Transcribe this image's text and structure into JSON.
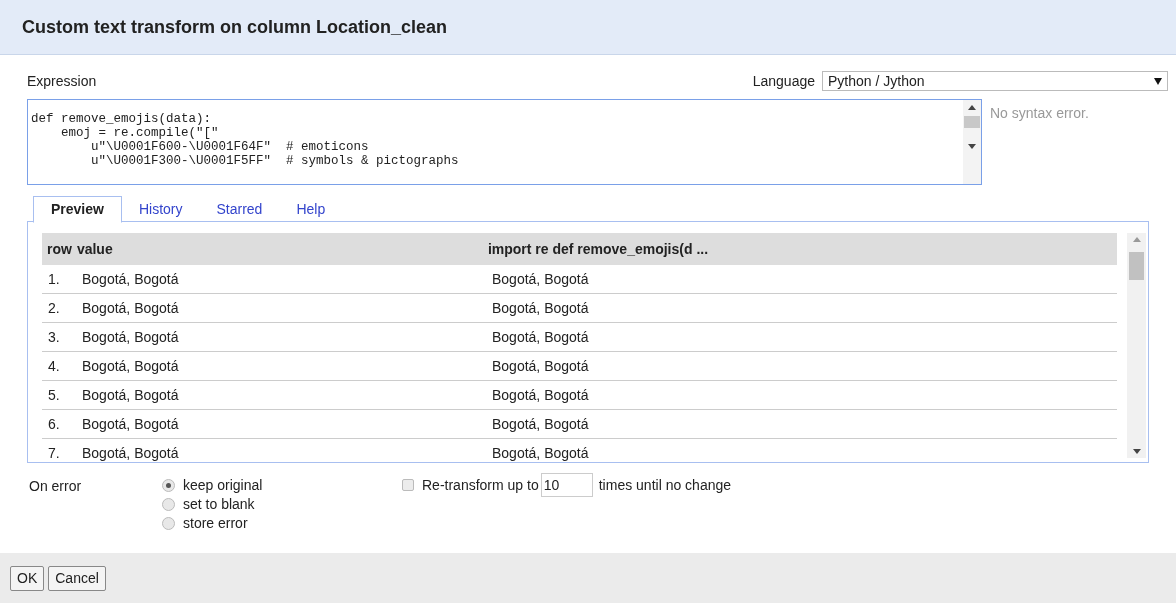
{
  "dialog": {
    "title": "Custom text transform on column Location_clean"
  },
  "expression": {
    "label": "Expression",
    "code": [
      "def remove_emojis(data):",
      "    emoj = re.compile(\"[\"",
      "        u\"\\U0001F600-\\U0001F64F\"  # emoticons",
      "        u\"\\U0001F300-\\U0001F5FF\"  # symbols & pictographs"
    ],
    "status": "No syntax error."
  },
  "language": {
    "label": "Language",
    "value": "Python / Jython"
  },
  "tabs": [
    {
      "label": "Preview",
      "selected": true
    },
    {
      "label": "History",
      "selected": false
    },
    {
      "label": "Starred",
      "selected": false
    },
    {
      "label": "Help",
      "selected": false
    }
  ],
  "table": {
    "columns": [
      "row",
      "value",
      "import re def remove_emojis(d ..."
    ],
    "rows": [
      {
        "row": "1.",
        "value": "Bogotá, Bogotá",
        "result": "Bogotá, Bogotá"
      },
      {
        "row": "2.",
        "value": "Bogotá, Bogotá",
        "result": "Bogotá, Bogotá"
      },
      {
        "row": "3.",
        "value": "Bogotá, Bogotá",
        "result": "Bogotá, Bogotá"
      },
      {
        "row": "4.",
        "value": "Bogotá, Bogotá",
        "result": "Bogotá, Bogotá"
      },
      {
        "row": "5.",
        "value": "Bogotá, Bogotá",
        "result": "Bogotá, Bogotá"
      },
      {
        "row": "6.",
        "value": "Bogotá, Bogotá",
        "result": "Bogotá, Bogotá"
      },
      {
        "row": "7.",
        "value": "Bogotá, Bogotá",
        "result": "Bogotá, Bogotá"
      }
    ]
  },
  "on_error": {
    "label": "On error",
    "options": [
      {
        "label": "keep original",
        "selected": true
      },
      {
        "label": "set to blank",
        "selected": false
      },
      {
        "label": "store error",
        "selected": false
      }
    ]
  },
  "retransform": {
    "checked": false,
    "label": "Re-transform up to",
    "count": "10",
    "suffix": "times until no change"
  },
  "buttons": [
    "OK",
    "Cancel"
  ]
}
